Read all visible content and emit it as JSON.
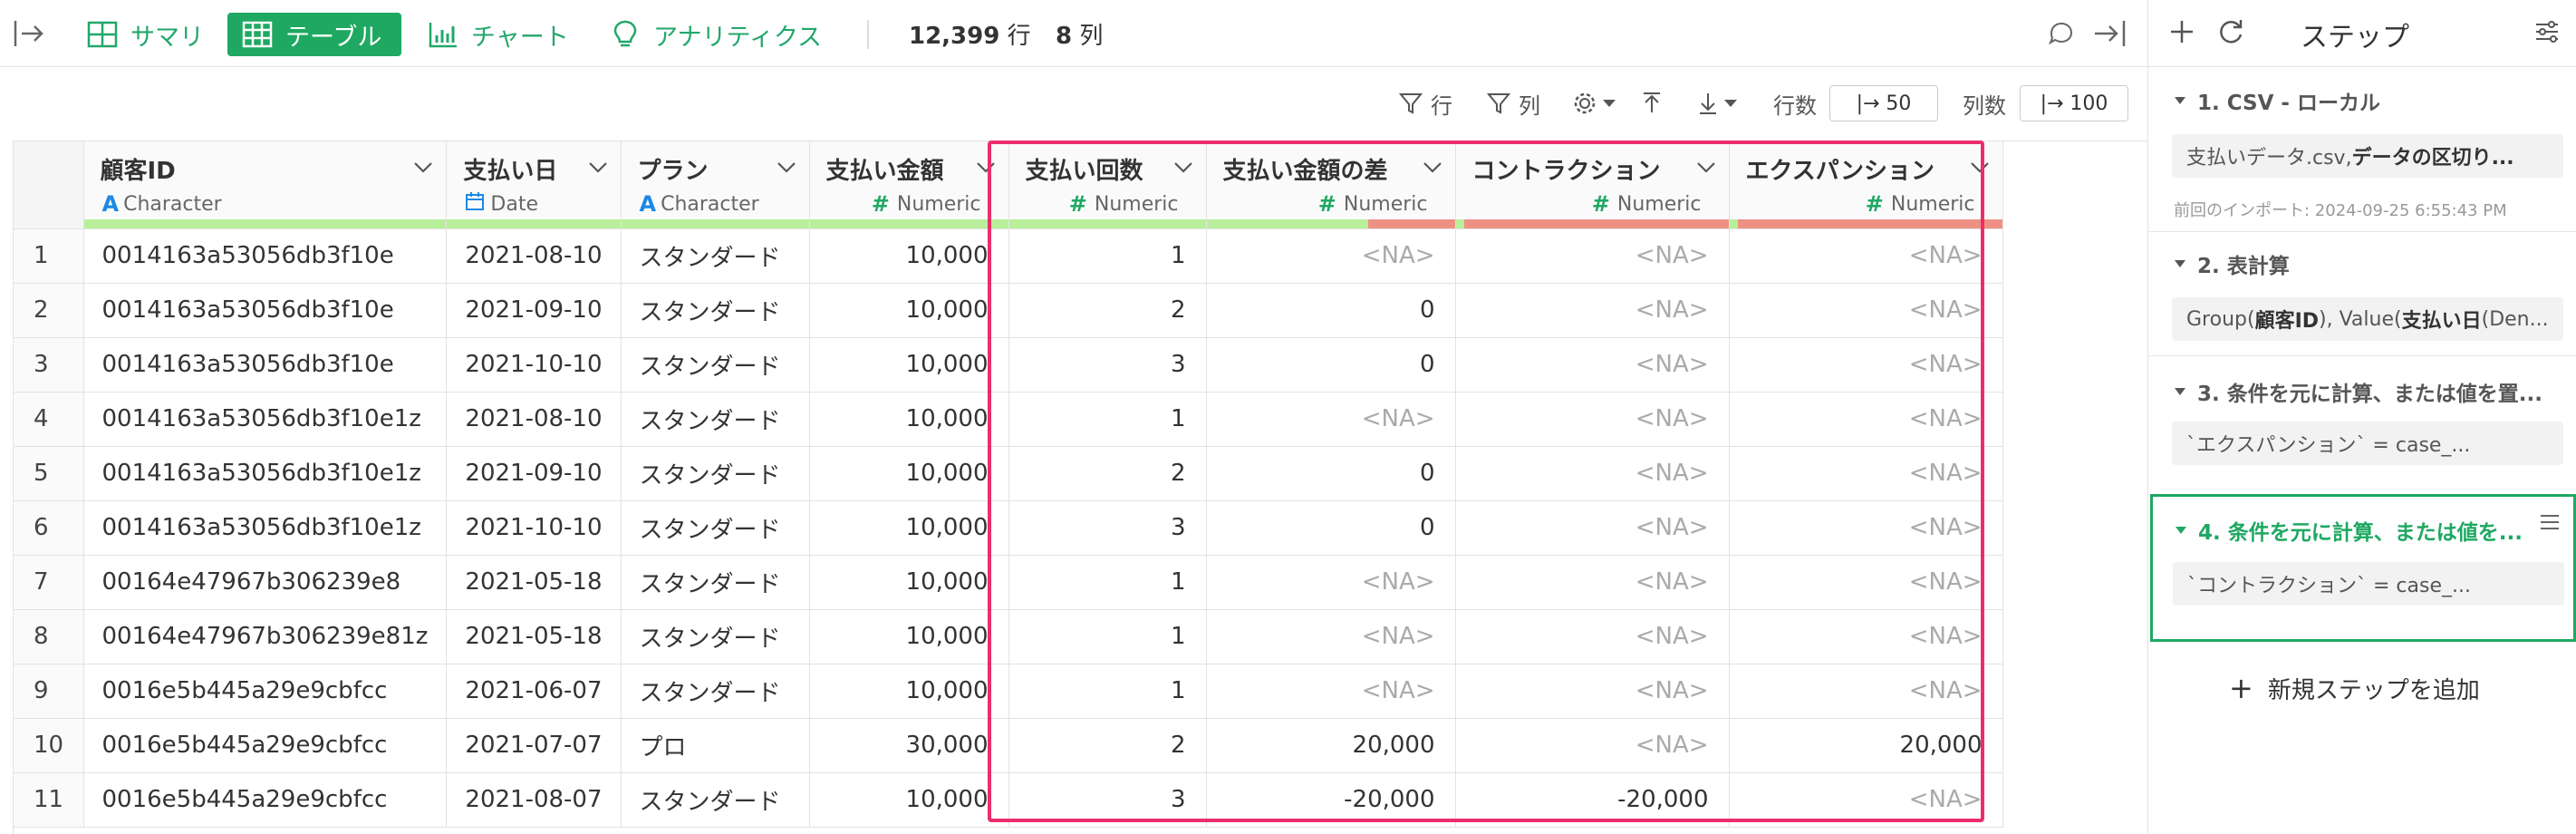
{
  "toolbar": {
    "tabs": [
      {
        "label": "サマリ",
        "icon": "summary-grid-icon"
      },
      {
        "label": "テーブル",
        "icon": "table-icon"
      },
      {
        "label": "チャート",
        "icon": "bar-chart-icon"
      },
      {
        "label": "アナリティクス",
        "icon": "lightbulb-icon"
      }
    ],
    "row_count": "12,399",
    "row_unit": "行",
    "col_count": "8",
    "col_unit": "列"
  },
  "subtoolbar": {
    "filter_row": "行",
    "filter_col": "列",
    "rows_label": "行数",
    "rows_value": "|→ 50",
    "cols_label": "列数",
    "cols_value": "|→ 100"
  },
  "table": {
    "columns": [
      {
        "name": "顧客ID",
        "type": "Character",
        "type_icon": "A"
      },
      {
        "name": "支払い日",
        "type": "Date",
        "type_icon": "calendar"
      },
      {
        "name": "プラン",
        "type": "Character",
        "type_icon": "A"
      },
      {
        "name": "支払い金額",
        "type": "Numeric",
        "type_icon": "#"
      },
      {
        "name": "支払い回数",
        "type": "Numeric",
        "type_icon": "#"
      },
      {
        "name": "支払い金額の差",
        "type": "Numeric",
        "type_icon": "#"
      },
      {
        "name": "コントラクション",
        "type": "Numeric",
        "type_icon": "#"
      },
      {
        "name": "エクスパンション",
        "type": "Numeric",
        "type_icon": "#"
      }
    ],
    "rows": [
      [
        "1",
        "0014163a53056db3f10e",
        "2021-08-10",
        "スタンダード",
        "10,000",
        "1",
        "<NA>",
        "<NA>",
        "<NA>"
      ],
      [
        "2",
        "0014163a53056db3f10e",
        "2021-09-10",
        "スタンダード",
        "10,000",
        "2",
        "0",
        "<NA>",
        "<NA>"
      ],
      [
        "3",
        "0014163a53056db3f10e",
        "2021-10-10",
        "スタンダード",
        "10,000",
        "3",
        "0",
        "<NA>",
        "<NA>"
      ],
      [
        "4",
        "0014163a53056db3f10e1z",
        "2021-08-10",
        "スタンダード",
        "10,000",
        "1",
        "<NA>",
        "<NA>",
        "<NA>"
      ],
      [
        "5",
        "0014163a53056db3f10e1z",
        "2021-09-10",
        "スタンダード",
        "10,000",
        "2",
        "0",
        "<NA>",
        "<NA>"
      ],
      [
        "6",
        "0014163a53056db3f10e1z",
        "2021-10-10",
        "スタンダード",
        "10,000",
        "3",
        "0",
        "<NA>",
        "<NA>"
      ],
      [
        "7",
        "00164e47967b306239e8",
        "2021-05-18",
        "スタンダード",
        "10,000",
        "1",
        "<NA>",
        "<NA>",
        "<NA>"
      ],
      [
        "8",
        "00164e47967b306239e81z",
        "2021-05-18",
        "スタンダード",
        "10,000",
        "1",
        "<NA>",
        "<NA>",
        "<NA>"
      ],
      [
        "9",
        "0016e5b445a29e9cbfcc",
        "2021-06-07",
        "スタンダード",
        "10,000",
        "1",
        "<NA>",
        "<NA>",
        "<NA>"
      ],
      [
        "10",
        "0016e5b445a29e9cbfcc",
        "2021-07-07",
        "プロ",
        "30,000",
        "2",
        "20,000",
        "<NA>",
        "20,000"
      ],
      [
        "11",
        "0016e5b445a29e9cbfcc",
        "2021-08-07",
        "スタンダード",
        "10,000",
        "3",
        "-20,000",
        "-20,000",
        "<NA>"
      ]
    ]
  },
  "panel": {
    "title": "ステップ",
    "steps": [
      {
        "title": "1. CSV - ローカル",
        "chip_pre": "支払いデータ.csv, ",
        "chip_bold": "データの区切り...",
        "sub": "前回のインポート: 2024-09-25 6:55:43 PM"
      },
      {
        "title": "2. 表計算",
        "chip_pre": "Group(",
        "chip_bold": "顧客ID",
        "chip_post": "), Value(",
        "chip_bold2": "支払い日",
        "chip_end": " (Den..."
      },
      {
        "title": "3. 条件を元に計算、または値を置...",
        "chip_pre": "`エクスパンション` = case_..."
      },
      {
        "title": "4. 条件を元に計算、または値を...",
        "chip_pre": "`コントラクション` = case_..."
      }
    ],
    "add_step": "新規ステップを追加"
  },
  "colors": {
    "accent": "#1fa862",
    "highlight": "#ea2e6b",
    "quality_valid": "#b9ef9a",
    "quality_missing": "#ee9184"
  }
}
